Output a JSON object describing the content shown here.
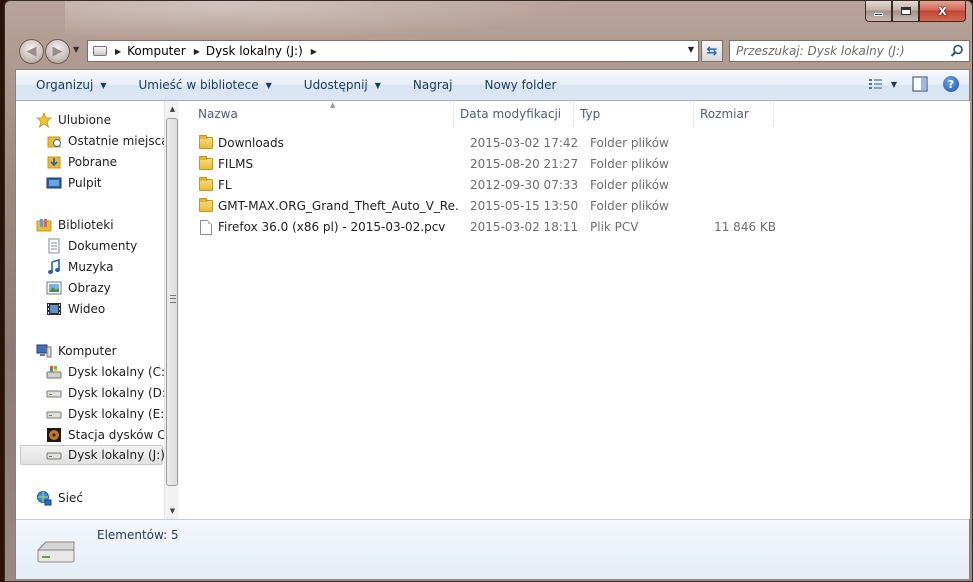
{
  "window": {
    "caption": {
      "minimize": "–",
      "maximize": "□",
      "close": "X"
    }
  },
  "address": {
    "crumbs": [
      "Komputer",
      "Dysk lokalny (J:)"
    ]
  },
  "search": {
    "placeholder": "Przeszukaj: Dysk lokalny (J:)"
  },
  "toolbar": {
    "organize": "Organizuj",
    "include_in_library": "Umieść w bibliotece",
    "share": "Udostępnij",
    "burn": "Nagraj",
    "new_folder": "Nowy folder",
    "help": "?"
  },
  "sidebar": {
    "favorites": {
      "label": "Ulubione",
      "items": [
        {
          "label": "Ostatnie miejsca",
          "icon": "recent-places-icon"
        },
        {
          "label": "Pobrane",
          "icon": "downloads-icon"
        },
        {
          "label": "Pulpit",
          "icon": "desktop-icon"
        }
      ]
    },
    "libraries": {
      "label": "Biblioteki",
      "items": [
        {
          "label": "Dokumenty",
          "icon": "documents-icon"
        },
        {
          "label": "Muzyka",
          "icon": "music-icon"
        },
        {
          "label": "Obrazy",
          "icon": "pictures-icon"
        },
        {
          "label": "Wideo",
          "icon": "video-icon"
        }
      ]
    },
    "computer": {
      "label": "Komputer",
      "items": [
        {
          "label": "Dysk lokalny (C:)",
          "icon": "system-drive-icon"
        },
        {
          "label": "Dysk lokalny (D:)",
          "icon": "drive-icon"
        },
        {
          "label": "Dysk lokalny (E:)",
          "icon": "drive-icon"
        },
        {
          "label": "Stacja dysków CD",
          "icon": "cd-drive-icon"
        },
        {
          "label": "Dysk lokalny (J:)",
          "icon": "drive-icon",
          "selected": true
        }
      ]
    },
    "network": {
      "label": "Sieć"
    }
  },
  "files": {
    "columns": {
      "name": "Nazwa",
      "modified": "Data modyfikacji",
      "type": "Typ",
      "size": "Rozmiar"
    },
    "rows": [
      {
        "name": "Downloads",
        "modified": "2015-03-02 17:42",
        "type": "Folder plików",
        "size": "",
        "icon": "folder-icon"
      },
      {
        "name": "FILMS",
        "modified": "2015-08-20 21:27",
        "type": "Folder plików",
        "size": "",
        "icon": "folder-icon"
      },
      {
        "name": "FL",
        "modified": "2012-09-30 07:33",
        "type": "Folder plików",
        "size": "",
        "icon": "folder-icon"
      },
      {
        "name": "GMT-MAX.ORG_Grand_Theft_Auto_V_Re...",
        "modified": "2015-05-15 13:50",
        "type": "Folder plików",
        "size": "",
        "icon": "folder-icon"
      },
      {
        "name": "Firefox 36.0 (x86 pl) - 2015-03-02.pcv",
        "modified": "2015-03-02 18:11",
        "type": "Plik PCV",
        "size": "11 846 KB",
        "icon": "file-icon"
      }
    ]
  },
  "details": {
    "count": "Elementów: 5"
  },
  "colors": {
    "accent": "#1e395b",
    "selection": "#e1e1e1",
    "folder": "#e9bb3a",
    "close_button": "#c24532"
  }
}
